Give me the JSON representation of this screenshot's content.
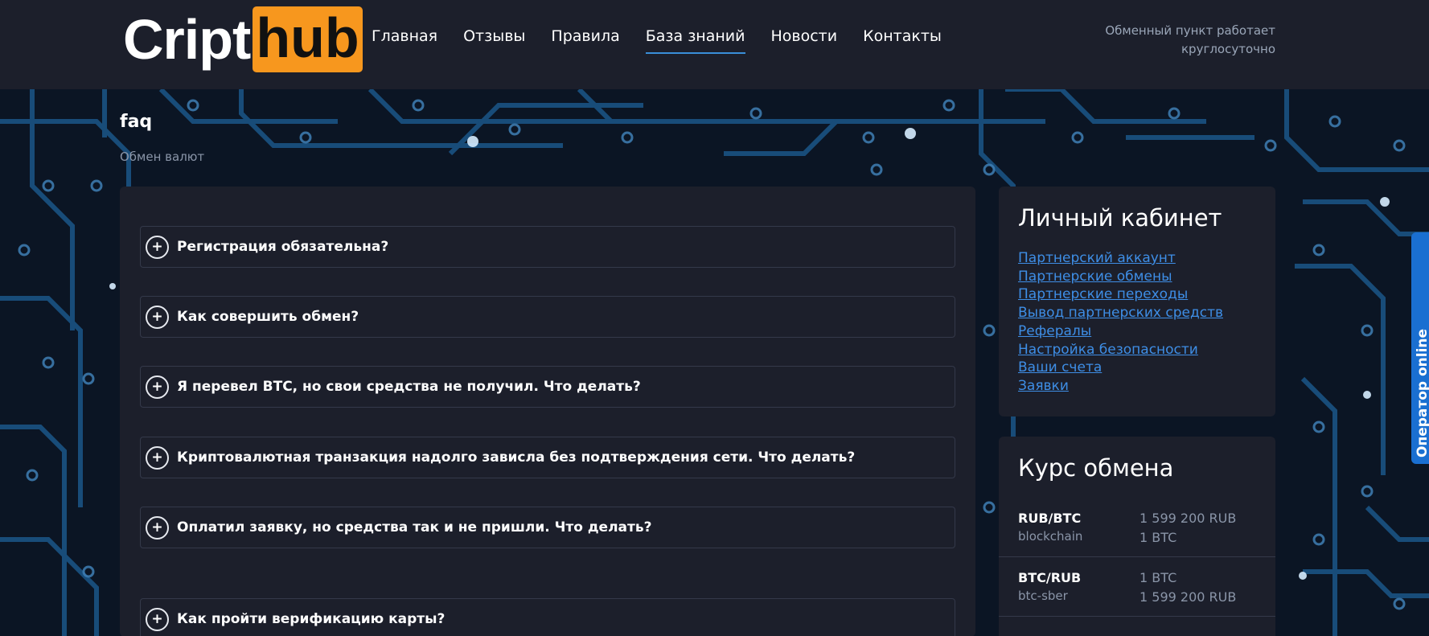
{
  "header": {
    "logo_part1": "Cript",
    "logo_part2": "hub",
    "nav": [
      "Главная",
      "Отзывы",
      "Правила",
      "База знаний",
      "Новости",
      "Контакты"
    ],
    "active_nav": "База знаний",
    "hours_line1": "Обменный пункт работает",
    "hours_line2": "круглосуточно"
  },
  "page": {
    "title": "faq",
    "breadcrumb": "Обмен валют"
  },
  "faq": {
    "items": [
      "Регистрация обязательна?",
      "Как совершить обмен?",
      "Я перевел BTC, но свои средства не получил. Что делать?",
      "Криптовалютная транзакция надолго зависла без подтверждения сети. Что делать?",
      "Оплатил заявку, но средства так и не пришли. Что делать?",
      "Как пройти верификацию карты?"
    ],
    "icon_glyph": "+"
  },
  "account": {
    "title": "Личный кабинет",
    "links": [
      "Партнерский аккаунт",
      "Партнерские обмены",
      "Партнерские переходы",
      "Вывод партнерских средств",
      "Рефералы",
      "Настройка безопасности",
      "Ваши счета",
      "Заявки"
    ]
  },
  "rates": {
    "title": "Курс обмена",
    "rows": [
      {
        "pair": "RUB/BTC",
        "network": "blockchain",
        "give": "1 599 200 RUB",
        "get": "1 BTC"
      },
      {
        "pair": "BTC/RUB",
        "network": "btc-sber",
        "give": "1 BTC",
        "get": "1 599 200 RUB"
      }
    ]
  },
  "operator": {
    "label": "Оператор online"
  },
  "colors": {
    "accent": "#f7971e",
    "link": "#3e8ee6",
    "panel": "#1c1f2b",
    "operator": "#1a6fd1"
  }
}
